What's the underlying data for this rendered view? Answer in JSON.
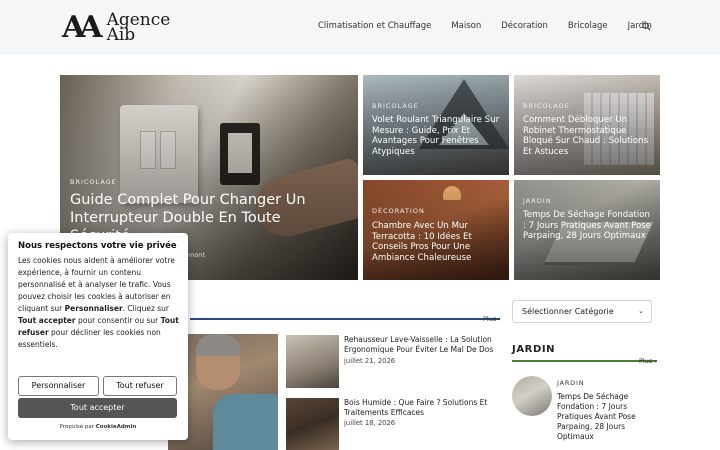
{
  "header": {
    "logo_mark": "AA",
    "logo_line1": "Agence",
    "logo_line2": "Aib",
    "nav": [
      "Climatisation et Chauffage",
      "Maison",
      "Décoration",
      "Bricolage",
      "Jardin"
    ]
  },
  "hero": {
    "category": "BRICOLAGE",
    "title": "Guide Complet Pour Changer Un Interrupteur Double En Toute Sécurité",
    "author_fragment": "mont"
  },
  "tiles": [
    {
      "category": "BRICOLAGE",
      "title": "Volet Roulant Triangulaire Sur Mesure : Guide, Prix Et Avantages Pour Fenêtres Atypiques"
    },
    {
      "category": "BRICOLAGE",
      "title": "Comment Débloquer Un Robinet Thermostatique Bloqué Sur Chaud : Solutions Et Astuces"
    },
    {
      "category": "DÉCORATION",
      "title": "Chambre Avec Un Mur Terracotta : 10 Idées Et Conseils Pros Pour Une Ambiance Chaleureuse"
    },
    {
      "category": "JARDIN",
      "title": "Temps De Séchage Fondation : 7 Jours Pratiques Avant Pose Parpaing, 28 Jours Optimaux"
    }
  ],
  "section": {
    "more_label": "Plus"
  },
  "articles": [
    {
      "title": "Rehausseur Lave-Vaisselle : La Solution Ergonomique Pour Éviter Le Mal De Dos",
      "date": "juillet 21, 2026"
    },
    {
      "title": "Bois Humide : Que Faire ? Solutions Et Traitements Efficaces",
      "date": "juillet 18, 2026"
    }
  ],
  "sidebar": {
    "select_label": "Sélectionner Catégorie",
    "heading": "JARDIN",
    "more_label": "Plus",
    "item": {
      "category": "JARDIN",
      "title": "Temps De Séchage Fondation : 7 Jours Pratiques Avant Pose Parpaing, 28 Jours Optimaux"
    }
  },
  "cookie": {
    "title": "Nous respectons votre vie privée",
    "body_1": "Les cookies nous aident à améliorer votre expérience, à fournir un contenu personnalisé et à analyser le trafic. Vous pouvez choisir les cookies à autoriser en cliquant sur ",
    "body_b1": "Personnaliser",
    "body_2": ". Cliquez sur ",
    "body_b2": "Tout accepter",
    "body_3": " pour consentir ou sur ",
    "body_b3": "Tout refuser",
    "body_4": " pour décliner les cookies non essentiels.",
    "btn_customize": "Personnaliser",
    "btn_refuse": "Tout refuser",
    "btn_accept": "Tout accepter",
    "powered_prefix": "Propulsé par",
    "powered_brand": "CookieAdmin"
  }
}
